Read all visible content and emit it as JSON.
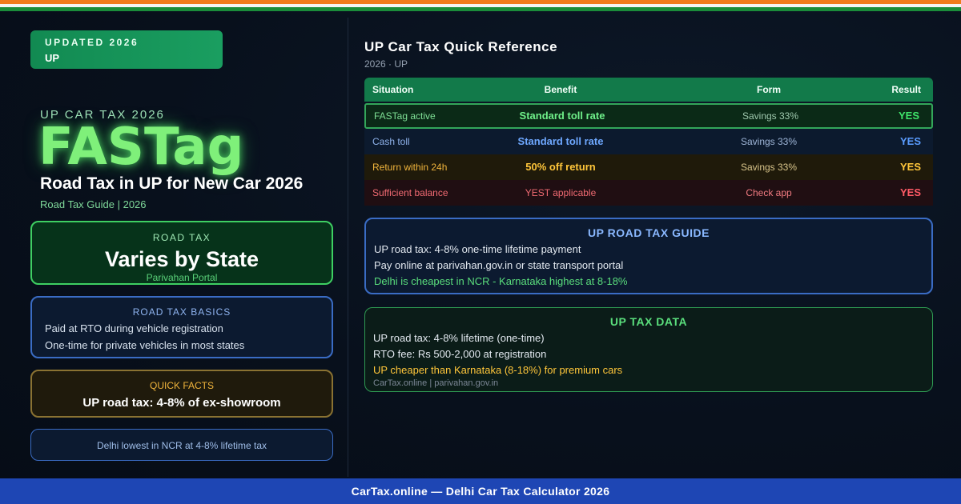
{
  "badge": {
    "top": "UPDATED 2026",
    "sub": "UP"
  },
  "hero": {
    "kicker": "UP CAR TAX 2026",
    "title": "FASTag",
    "headline": "Road Tax in UP for New Car 2026",
    "subline": "Road Tax Guide | 2026"
  },
  "road_tax_card": {
    "label": "ROAD TAX",
    "value": "Varies by State",
    "note": "Parivahan Portal"
  },
  "basics_card": {
    "label": "ROAD TAX BASICS",
    "lines": [
      "Paid at RTO during vehicle registration",
      "One-time for private vehicles in most states"
    ]
  },
  "facts_card": {
    "label": "QUICK FACTS",
    "value": "UP road tax: 4-8% of ex-showroom"
  },
  "note_card": {
    "text": "Delhi lowest in NCR at 4-8% lifetime tax"
  },
  "reference": {
    "title": "UP Car Tax Quick Reference",
    "subtitle": "2026 · UP",
    "headers": [
      "Situation",
      "Benefit",
      "Form",
      "Result"
    ],
    "rows": [
      {
        "situation": "FASTag active",
        "benefit": "Standard toll rate",
        "form": "Savings 33%",
        "result": "YES"
      },
      {
        "situation": "Cash toll",
        "benefit": "Standard toll rate",
        "form": "Savings 33%",
        "result": "YES"
      },
      {
        "situation": "Return within 24h",
        "benefit": "50% off return",
        "form": "Savings 33%",
        "result": "YES"
      },
      {
        "situation": "Sufficient balance",
        "benefit": "YEST applicable",
        "form": "Check app",
        "result": "YES"
      }
    ]
  },
  "guide": {
    "title": "UP ROAD TAX GUIDE",
    "lines": [
      "UP road tax: 4-8% one-time lifetime payment",
      "Pay online at parivahan.gov.in or state transport portal",
      "Delhi is cheapest in NCR - Karnataka highest at 8-18%"
    ]
  },
  "tax_data": {
    "title": "UP TAX DATA",
    "lines": [
      "UP road tax: 4-8% lifetime (one-time)",
      "RTO fee: Rs 500-2,000 at registration",
      "UP cheaper than Karnataka (8-18%) for premium cars"
    ],
    "source": "CarTax.online | parivahan.gov.in"
  },
  "footer": {
    "text": "CarTax.online — Delhi Car Tax Calculator 2026"
  },
  "colors": {
    "saffron": "#f07b1d",
    "green_accent": "#3ecf62",
    "blue_accent": "#3a6cc4",
    "amber_accent": "#f0b43c",
    "red_accent": "#ff5a66",
    "footer_blue": "#1e46b4"
  }
}
